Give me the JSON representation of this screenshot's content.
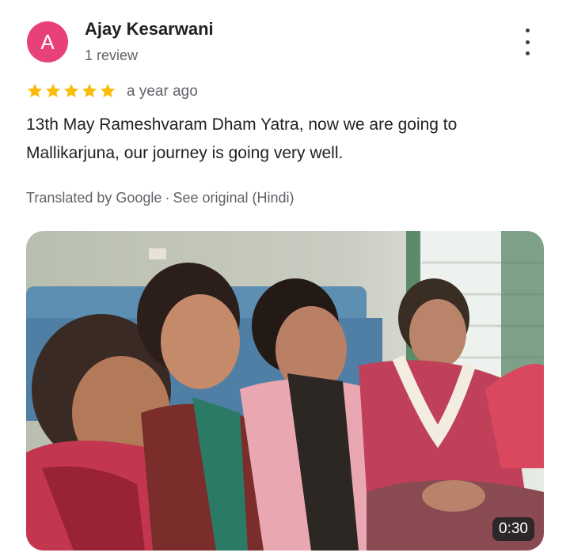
{
  "reviewer": {
    "avatar_letter": "A",
    "avatar_color": "#e8407a",
    "name": "Ajay Kesarwani",
    "review_count": "1 review"
  },
  "review": {
    "rating": 5,
    "star_color": "#fbbc04",
    "time_ago": "a year ago",
    "text": "13th May Rameshvaram Dham Yatra, now we are going to Mallikarjuna, our journey is going very well."
  },
  "translation": {
    "translated_by": "Translated by Google",
    "separator": "·",
    "see_original": "See original (Hindi)"
  },
  "media": {
    "type": "video",
    "duration": "0:30"
  },
  "icons": {
    "menu": "more-vertical-icon",
    "star": "star-icon"
  }
}
